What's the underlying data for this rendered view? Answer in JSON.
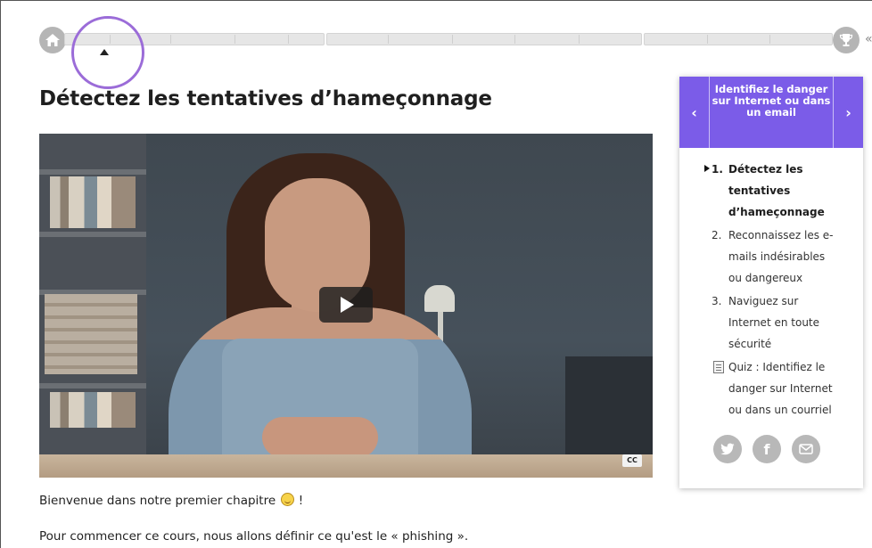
{
  "progress": {
    "home_icon": "home-icon",
    "trophy_icon": "trophy-icon",
    "trail_char": "«"
  },
  "course": {
    "title": "Détectez les tentatives d’hameçonnage"
  },
  "video": {
    "cc_label": "CC",
    "play_icon": "play-icon"
  },
  "content": {
    "para1": "Bienvenue dans notre premier chapitre",
    "para1_end": " !",
    "para2": "Pour commencer ce cours, nous allons définir ce qu'est le « phishing »."
  },
  "sidebar": {
    "prev_label": "‹",
    "next_label": "›",
    "part_title": "Identifiez le danger sur Internet ou dans un email",
    "items": [
      {
        "num": "1.",
        "lines": [
          "Détectez les",
          "tentatives",
          "d’hameçonnage"
        ],
        "active": true
      },
      {
        "num": "2.",
        "lines": [
          "Reconnaissez les e-",
          "mails indésirables",
          "ou dangereux"
        ],
        "active": false
      },
      {
        "num": "3.",
        "lines": [
          "Naviguez sur",
          "Internet en toute",
          "sécurité"
        ],
        "active": false
      }
    ],
    "quiz_lines": [
      "Quiz : Identifiez le",
      "danger sur Internet",
      "ou dans un courriel"
    ],
    "share": {
      "twitter_icon": "twitter-icon",
      "facebook_label": "f",
      "email_icon": "email-icon"
    }
  },
  "colors": {
    "accent": "#7b5ce8",
    "highlight_ring": "#9b6cd8"
  }
}
